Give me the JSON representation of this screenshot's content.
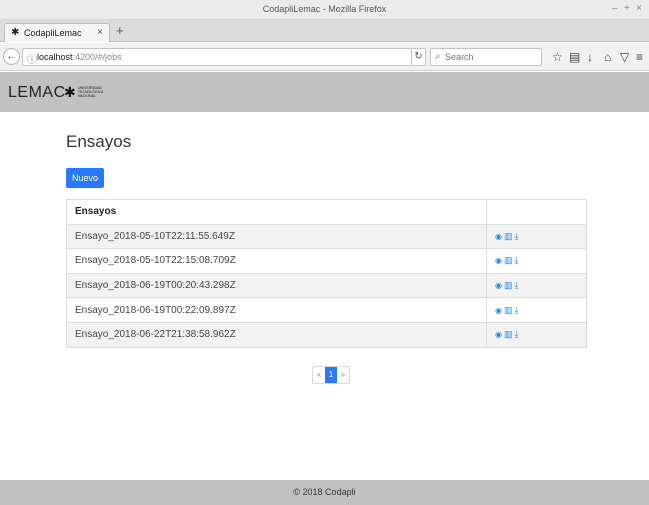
{
  "window": {
    "title": "CodapliLemac - Mozilla Firefox",
    "controls": [
      "–",
      "+",
      "×"
    ]
  },
  "tab": {
    "label": "CodapliLemac",
    "favicon": "✱",
    "close": "×",
    "new_tab": "+"
  },
  "navbar": {
    "url_host": "localhost",
    "url_path": ":4200/#/jobs",
    "search_placeholder": "Search",
    "icons": {
      "back": "←",
      "info": "ⓘ",
      "reload": "↻",
      "search": "⌕",
      "bookmark": "☆",
      "reader": "▤",
      "download": "↓",
      "home": "⌂",
      "pocket": "▽",
      "menu": "≡"
    }
  },
  "header": {
    "brand": "LEMAC",
    "logo_lines": [
      "UNIVERSIDAD",
      "TECNOLÓGICA",
      "NACIONAL"
    ],
    "logo_star": "✱"
  },
  "main": {
    "title": "Ensayos",
    "new_button": "Nuevo",
    "table": {
      "headers": [
        "Ensayos",
        ""
      ],
      "rows": [
        {
          "name": "Ensayo_2018-05-10T22:11:55.649Z"
        },
        {
          "name": "Ensayo_2018-05-10T22:15:08.709Z"
        },
        {
          "name": "Ensayo_2018-06-19T00:20:43.298Z"
        },
        {
          "name": "Ensayo_2018-06-19T00:22:09.897Z"
        },
        {
          "name": "Ensayo_2018-06-22T21:38:58.962Z"
        }
      ],
      "action_icons": {
        "view": "◉",
        "delete": "▥",
        "download": "⤓"
      }
    },
    "pagination": {
      "prev": "«",
      "current": "1",
      "next": "»"
    }
  },
  "footer": {
    "text": "© 2018 Codapli"
  },
  "colors": {
    "primary": "#2979ff",
    "header_bg": "#c1c1c1",
    "icon_blue": "#1e88e5"
  }
}
